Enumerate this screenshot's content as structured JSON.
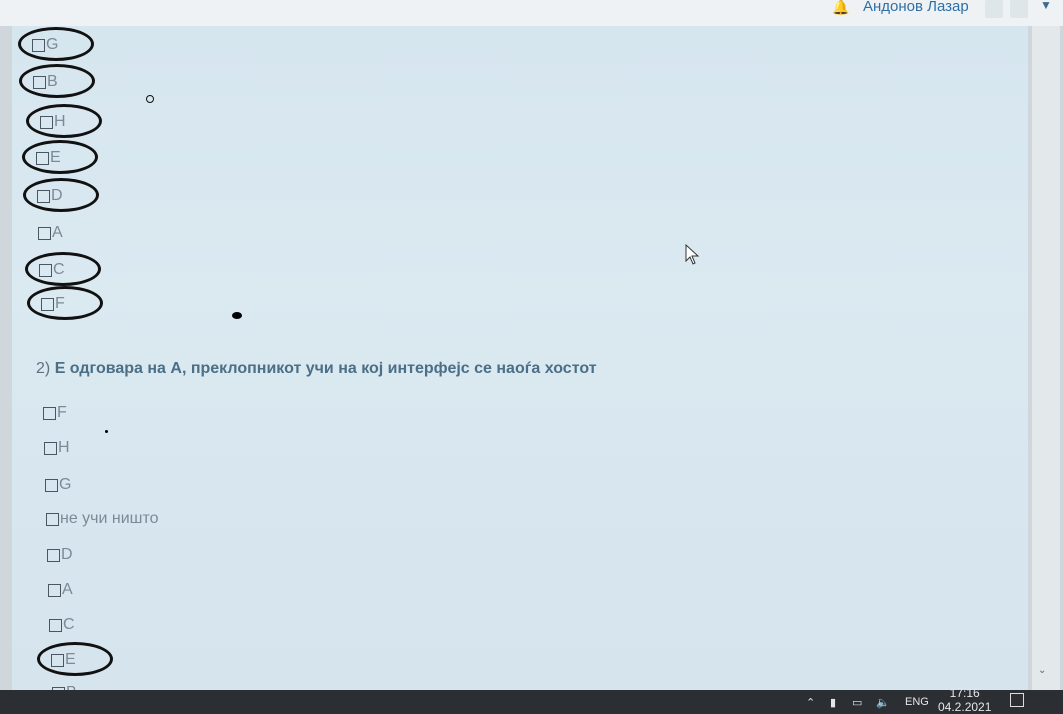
{
  "header": {
    "username": "Андонов Лазар"
  },
  "question1": {
    "options": [
      "G",
      "B",
      "H",
      "E",
      "D",
      "A",
      "C",
      "F"
    ]
  },
  "question2": {
    "number": "2)",
    "text": "Е одговара на А, преклопникот учи на кој интерфејс се наоѓа хостот",
    "options": [
      "F",
      "H",
      "G",
      "не учи ништо",
      "D",
      "A",
      "C",
      "E",
      "B"
    ]
  },
  "taskbar": {
    "language": "ENG",
    "time": "17:16",
    "date": "04.2.2021"
  }
}
